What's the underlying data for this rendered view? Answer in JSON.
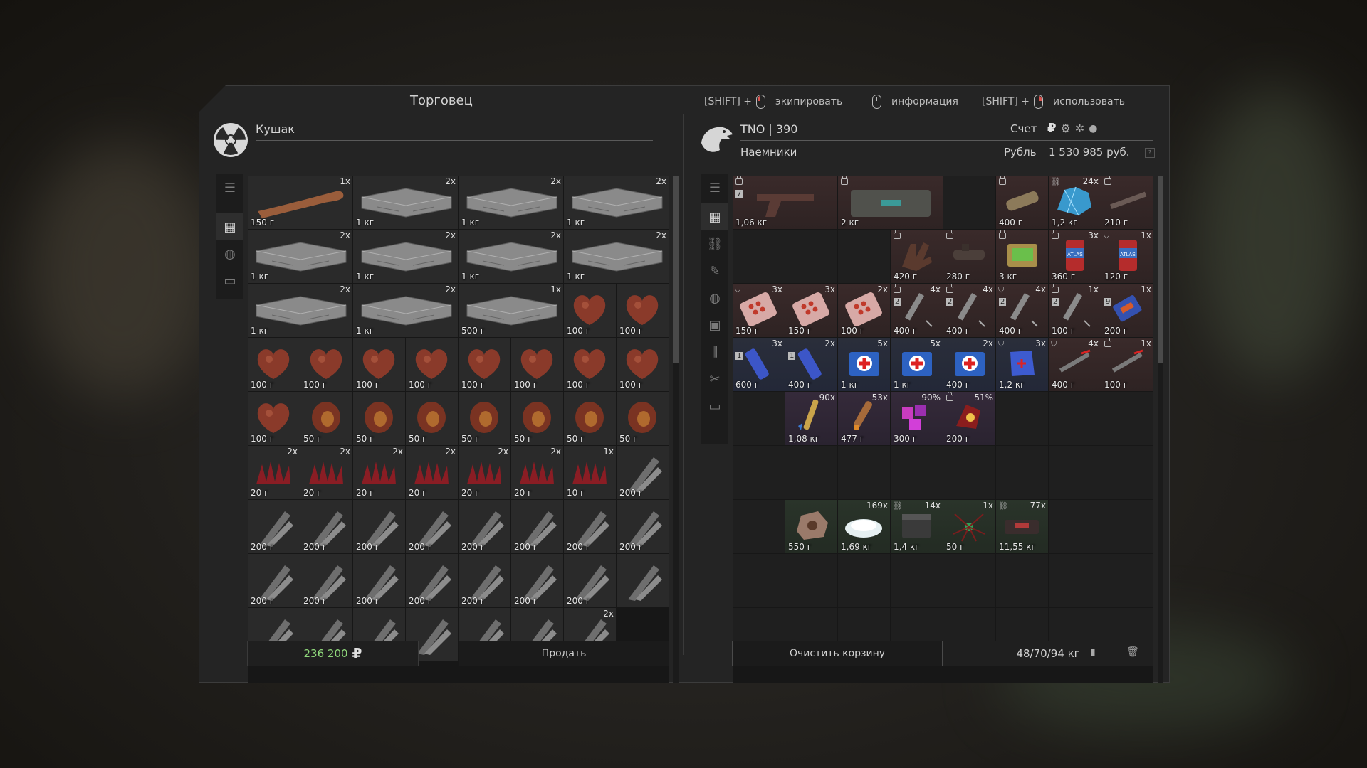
{
  "window": {
    "title": "Торговец",
    "hints": [
      {
        "prefix": "[SHIFT] +",
        "label": "экипировать",
        "icon": "mouse-left-icon"
      },
      {
        "prefix": "",
        "label": "информация",
        "icon": "mouse-middle-icon"
      },
      {
        "prefix": "[SHIFT] +",
        "label": "использовать",
        "icon": "mouse-right-icon"
      }
    ]
  },
  "trader": {
    "name": "Кушак",
    "avatar_icon": "radiation-symbol-icon",
    "sum_value": "236 200",
    "currency_symbol": "₽",
    "sell_label": "Продать",
    "items": [
      {
        "count": "1x",
        "value": "150 г",
        "art": "bone",
        "wide": true
      },
      {
        "count": "2x",
        "value": "1 кг",
        "art": "plate",
        "wide": true
      },
      {
        "count": "2x",
        "value": "1 кг",
        "art": "plate",
        "wide": true
      },
      {
        "count": "2x",
        "value": "1 кг",
        "art": "plate",
        "wide": true
      },
      {
        "count": "2x",
        "value": "1 кг",
        "art": "plate",
        "wide": true
      },
      {
        "count": "2x",
        "value": "1 кг",
        "art": "plate",
        "wide": true
      },
      {
        "count": "2x",
        "value": "1 кг",
        "art": "plate",
        "wide": true
      },
      {
        "count": "2x",
        "value": "1 кг",
        "art": "plate",
        "wide": true
      },
      {
        "count": "2x",
        "value": "1 кг",
        "art": "plate",
        "wide": true
      },
      {
        "count": "2x",
        "value": "1 кг",
        "art": "plate",
        "wide": true
      },
      {
        "count": "1x",
        "value": "500 г",
        "art": "plate",
        "wide": true
      },
      {
        "count": "",
        "value": "100 г",
        "art": "heart"
      },
      {
        "count": "",
        "value": "100 г",
        "art": "heart"
      },
      {
        "count": "",
        "value": "100 г",
        "art": "heart"
      },
      {
        "count": "",
        "value": "100 г",
        "art": "heart"
      },
      {
        "count": "",
        "value": "100 г",
        "art": "heart"
      },
      {
        "count": "",
        "value": "100 г",
        "art": "heart"
      },
      {
        "count": "",
        "value": "100 г",
        "art": "heart"
      },
      {
        "count": "",
        "value": "100 г",
        "art": "heart"
      },
      {
        "count": "",
        "value": "100 г",
        "art": "heart"
      },
      {
        "count": "",
        "value": "100 г",
        "art": "heart"
      },
      {
        "count": "",
        "value": "100 г",
        "art": "heart"
      },
      {
        "count": "",
        "value": "50 г",
        "art": "gland"
      },
      {
        "count": "",
        "value": "50 г",
        "art": "gland"
      },
      {
        "count": "",
        "value": "50 г",
        "art": "gland"
      },
      {
        "count": "",
        "value": "50 г",
        "art": "gland"
      },
      {
        "count": "",
        "value": "50 г",
        "art": "gland"
      },
      {
        "count": "",
        "value": "50 г",
        "art": "gland"
      },
      {
        "count": "",
        "value": "50 г",
        "art": "gland"
      },
      {
        "count": "2x",
        "value": "20 г",
        "art": "spikes"
      },
      {
        "count": "2x",
        "value": "20 г",
        "art": "spikes"
      },
      {
        "count": "2x",
        "value": "20 г",
        "art": "spikes"
      },
      {
        "count": "2x",
        "value": "20 г",
        "art": "spikes"
      },
      {
        "count": "2x",
        "value": "20 г",
        "art": "spikes"
      },
      {
        "count": "2x",
        "value": "20 г",
        "art": "spikes"
      },
      {
        "count": "1x",
        "value": "10 г",
        "art": "spikes"
      },
      {
        "count": "",
        "value": "200 г",
        "art": "claw"
      },
      {
        "count": "",
        "value": "200 г",
        "art": "claw"
      },
      {
        "count": "",
        "value": "200 г",
        "art": "claw"
      },
      {
        "count": "",
        "value": "200 г",
        "art": "claw"
      },
      {
        "count": "",
        "value": "200 г",
        "art": "claw"
      },
      {
        "count": "",
        "value": "200 г",
        "art": "claw"
      },
      {
        "count": "",
        "value": "200 г",
        "art": "claw"
      },
      {
        "count": "",
        "value": "200 г",
        "art": "claw"
      },
      {
        "count": "",
        "value": "200 г",
        "art": "claw"
      },
      {
        "count": "",
        "value": "200 г",
        "art": "claw"
      },
      {
        "count": "",
        "value": "200 г",
        "art": "claw"
      },
      {
        "count": "",
        "value": "200 г",
        "art": "claw"
      },
      {
        "count": "",
        "value": "200 г",
        "art": "claw"
      },
      {
        "count": "",
        "value": "200 г",
        "art": "claw"
      },
      {
        "count": "",
        "value": "200 г",
        "art": "claw"
      },
      {
        "count": "",
        "value": "200 г",
        "art": "claw"
      },
      {
        "count": "",
        "value": "",
        "art": "claw"
      },
      {
        "count": "",
        "value": "",
        "art": "claw"
      },
      {
        "count": "",
        "value": "",
        "art": "claw"
      },
      {
        "count": "",
        "value": "",
        "art": "claw"
      },
      {
        "count": "",
        "value": "",
        "art": "claw"
      },
      {
        "count": "",
        "value": "",
        "art": "claw"
      },
      {
        "count": "",
        "value": "",
        "art": "claw"
      },
      {
        "count": "2x",
        "value": "",
        "art": "claw"
      }
    ]
  },
  "player": {
    "name": "TNO | 390",
    "faction": "Наемники",
    "avatar_icon": "eagle-icon",
    "account_label": "Счет",
    "currency_label": "Рубль",
    "balance": "1 530 985 руб.",
    "currency_icons": [
      "ruble-icon",
      "gear-currency-icon",
      "cog-currency-icon",
      "coin-icon"
    ],
    "clear_cart_label": "Очистить корзину",
    "weight": "48/70/94 кг",
    "items": [
      {
        "count": "",
        "value": "1,06 кг",
        "art": "pistol",
        "wide": true,
        "tint": "red",
        "lock": true,
        "badge": "7"
      },
      {
        "count": "",
        "value": "2 кг",
        "art": "case",
        "wide": true,
        "tint": "red",
        "lock": true
      },
      {
        "empty": true
      },
      {
        "count": "",
        "value": "400 г",
        "art": "silencer",
        "tint": "red",
        "lock": true
      },
      {
        "count": "24x",
        "value": "1,2 кг",
        "art": "crystal",
        "tint": "red",
        "link": true
      },
      {
        "count": "",
        "value": "210 г",
        "art": "rod",
        "tint": "red",
        "lock": true
      },
      {
        "empty": true
      },
      {
        "empty": true
      },
      {
        "empty": true
      },
      {
        "count": "",
        "value": "420 г",
        "art": "gloves",
        "tint": "red",
        "lock": true
      },
      {
        "count": "",
        "value": "280 г",
        "art": "scope",
        "tint": "red",
        "lock": true
      },
      {
        "count": "",
        "value": "3 кг",
        "art": "device",
        "tint": "red",
        "lock": true
      },
      {
        "count": "3x",
        "value": "360 г",
        "art": "can",
        "tint": "red",
        "lock": true
      },
      {
        "count": "1x",
        "value": "120 г",
        "art": "can",
        "tint": "red",
        "shield": true
      },
      {
        "count": "3x",
        "value": "150 г",
        "art": "pills",
        "tint": "red",
        "shield": true
      },
      {
        "count": "3x",
        "value": "150 г",
        "art": "pills",
        "tint": "red"
      },
      {
        "count": "2x",
        "value": "100 г",
        "art": "pills",
        "tint": "red"
      },
      {
        "count": "4x",
        "value": "400 г",
        "art": "syringe",
        "tint": "red",
        "lock": true,
        "badge": "2"
      },
      {
        "count": "4x",
        "value": "400 г",
        "art": "syringe",
        "tint": "red",
        "lock": true,
        "badge": "2"
      },
      {
        "count": "4x",
        "value": "400 г",
        "art": "syringe",
        "tint": "red",
        "shield": true,
        "badge": "2"
      },
      {
        "count": "1x",
        "value": "100 г",
        "art": "syringe",
        "tint": "red",
        "lock": true,
        "badge": "2"
      },
      {
        "count": "1x",
        "value": "200 г",
        "art": "pack",
        "tint": "red",
        "badge": "9"
      },
      {
        "count": "3x",
        "value": "600 г",
        "art": "tube",
        "tint": "blue",
        "badge": "1"
      },
      {
        "count": "2x",
        "value": "400 г",
        "art": "tube",
        "tint": "blue",
        "badge": "1"
      },
      {
        "count": "5x",
        "value": "1 кг",
        "art": "medkit",
        "tint": "blue"
      },
      {
        "count": "5x",
        "value": "1 кг",
        "art": "medkit",
        "tint": "blue"
      },
      {
        "count": "2x",
        "value": "400 г",
        "art": "medkit",
        "tint": "blue"
      },
      {
        "count": "3x",
        "value": "1,2 кг",
        "art": "bag",
        "tint": "blue",
        "shield": true
      },
      {
        "count": "4x",
        "value": "400 г",
        "art": "injector",
        "tint": "red",
        "shield": true
      },
      {
        "count": "1x",
        "value": "100 г",
        "art": "injector",
        "tint": "red",
        "lock": true
      },
      {
        "empty": true
      },
      {
        "count": "90x",
        "value": "1,08 кг",
        "art": "cartridge",
        "tint": "violet"
      },
      {
        "count": "53x",
        "value": "477 г",
        "art": "bullet",
        "tint": "violet"
      },
      {
        "count": "90%",
        "value": "300 г",
        "art": "cubes",
        "tint": "violet"
      },
      {
        "count": "51%",
        "value": "200 г",
        "art": "artifact",
        "tint": "violet",
        "lock": true
      },
      {
        "empty": true
      },
      {
        "empty": true
      },
      {
        "empty": true
      },
      {
        "empty": true
      },
      {
        "empty": true
      },
      {
        "empty": true
      },
      {
        "empty": true
      },
      {
        "empty": true
      },
      {
        "empty": true
      },
      {
        "empty": true
      },
      {
        "empty": true
      },
      {
        "empty": true
      },
      {
        "count": "",
        "value": "550 г",
        "art": "rock",
        "tint": "green"
      },
      {
        "count": "169x",
        "value": "1,69 кг",
        "art": "powder",
        "tint": "green"
      },
      {
        "count": "14x",
        "value": "1,4 кг",
        "art": "box",
        "tint": "green",
        "link": true
      },
      {
        "count": "1x",
        "value": "50 г",
        "art": "spider",
        "tint": "green"
      },
      {
        "count": "77x",
        "value": "11,55 кг",
        "art": "tray",
        "tint": "green",
        "link": true
      },
      {
        "empty": true
      },
      {
        "empty": true
      },
      {
        "empty": true
      },
      {
        "empty": true
      },
      {
        "empty": true
      },
      {
        "empty": true
      },
      {
        "empty": true
      },
      {
        "empty": true
      },
      {
        "empty": true
      },
      {
        "empty": true
      },
      {
        "empty": true
      },
      {
        "empty": true
      },
      {
        "empty": true
      },
      {
        "empty": true
      },
      {
        "empty": true
      },
      {
        "empty": true
      },
      {
        "empty": true
      },
      {
        "empty": true
      }
    ]
  },
  "colors": {
    "accent_green": "#8fd87b",
    "lock_red": "#d9534f"
  }
}
